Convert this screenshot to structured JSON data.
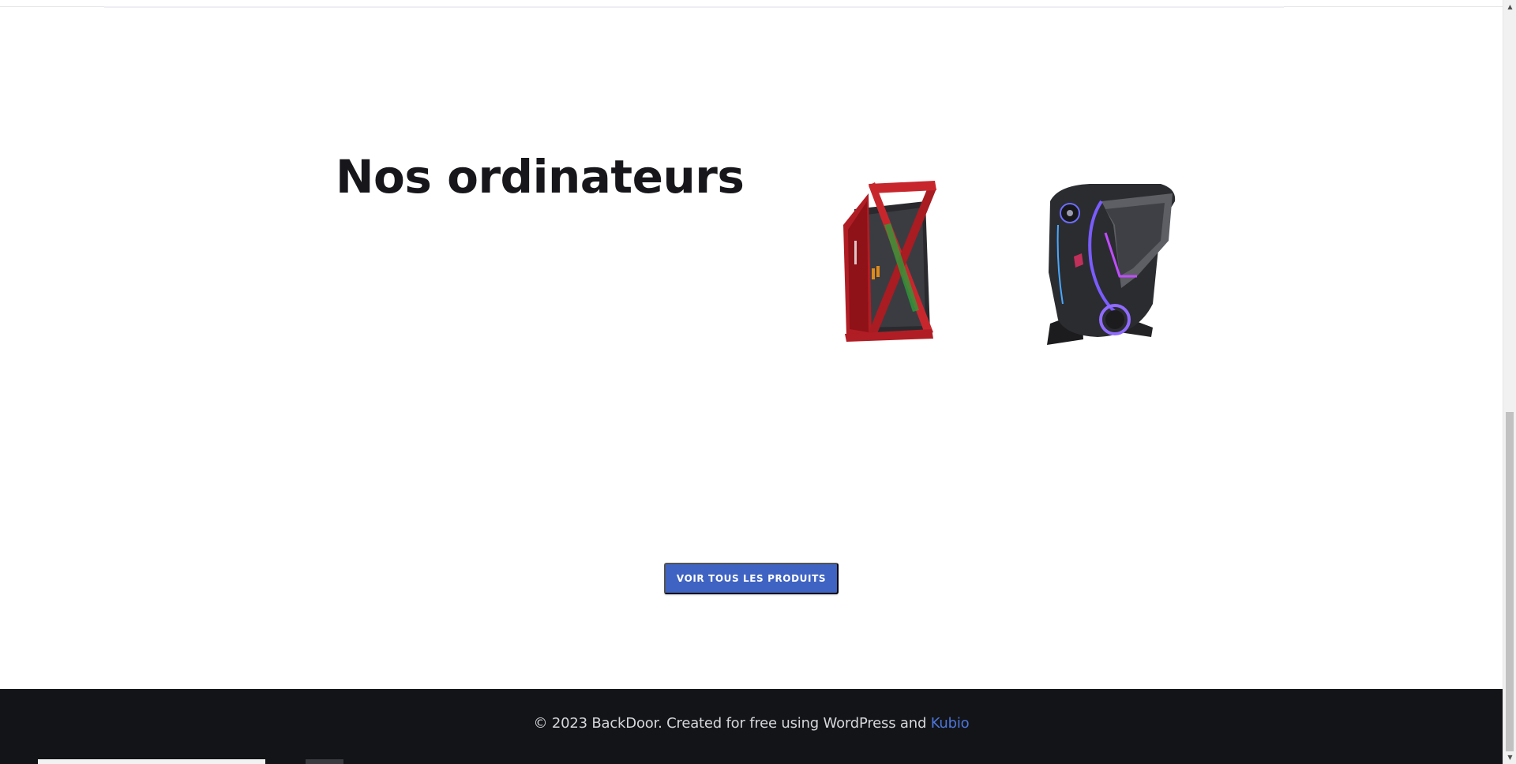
{
  "section": {
    "heading": "Nos ordinateurs"
  },
  "products": [
    {
      "name": "red-tower-pc-image",
      "icon": "red-gaming-pc"
    },
    {
      "name": "black-rgb-pc-image",
      "icon": "black-gaming-pc"
    }
  ],
  "cta": {
    "label": "VOIR TOUS LES PRODUITS"
  },
  "footer": {
    "text": "© 2023 BackDoor. Created for free using WordPress and ",
    "link": "Kubio"
  },
  "colors": {
    "cta_bg": "#3f63c2",
    "footer_bg": "#131417",
    "link": "#4d76db",
    "heading": "#17171b"
  }
}
